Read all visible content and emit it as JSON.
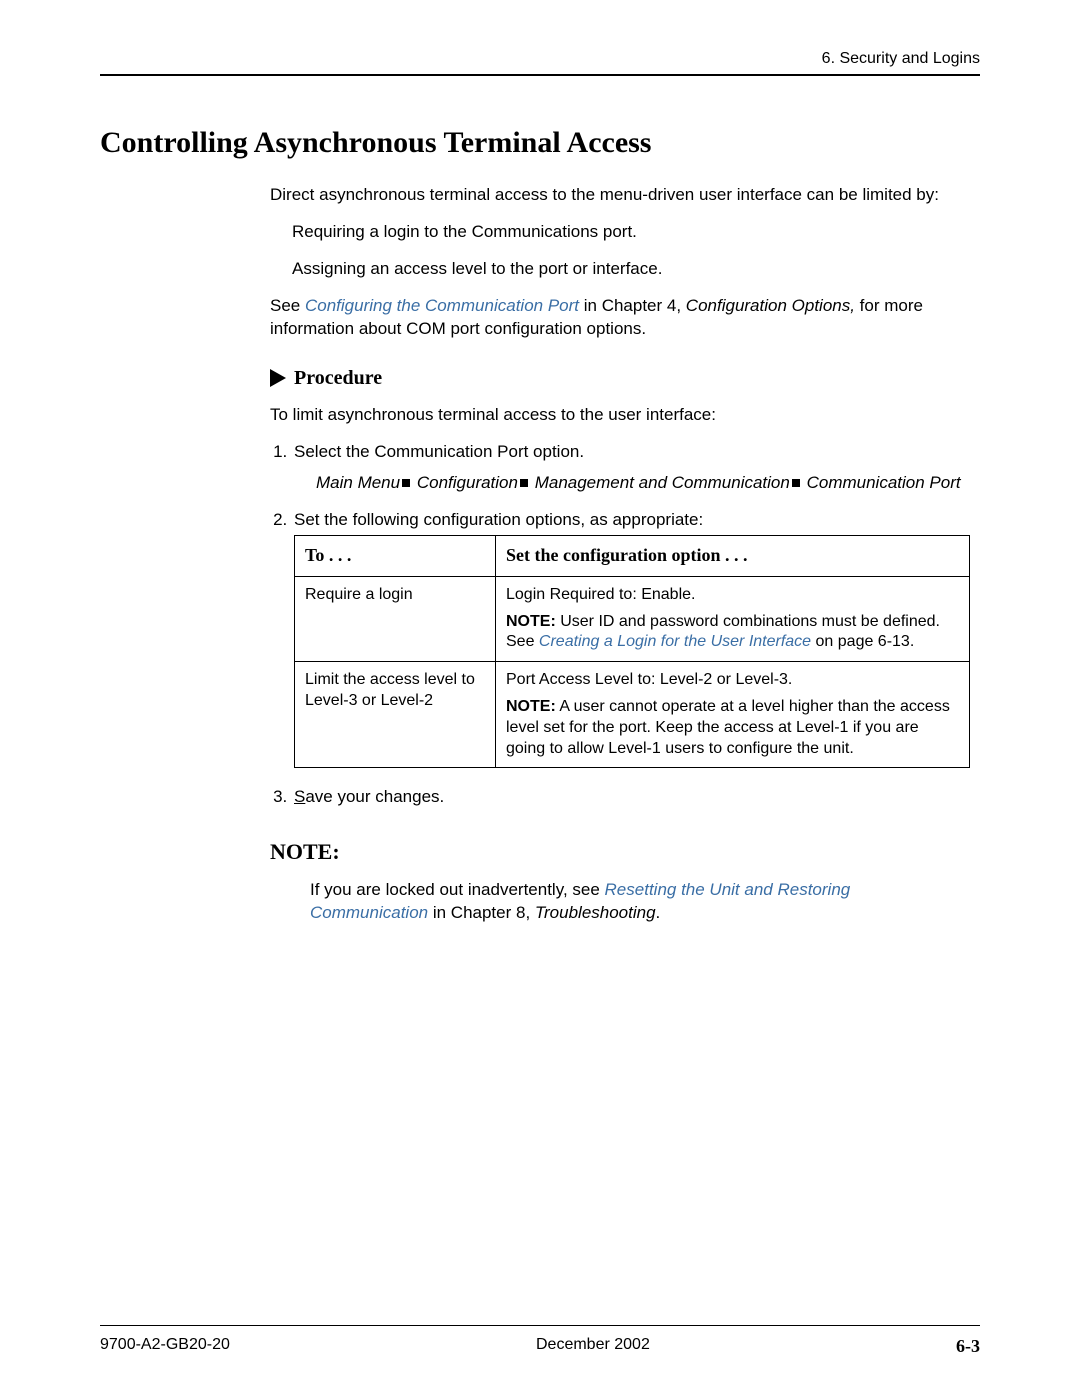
{
  "header": {
    "right": "6. Security and Logins"
  },
  "title": "Controlling Asynchronous Terminal Access",
  "intro": {
    "p1": "Direct asynchronous terminal access to the menu-driven user interface can be limited by:",
    "req1": "Requiring a login to the Communications port.",
    "req2": "Assigning an access level to the port or interface.",
    "see_prefix": "See ",
    "see_link": "Configuring the Communication Port",
    "see_mid": " in Chapter 4, ",
    "see_chapter": "Configuration Options,",
    "see_suffix": " for more information about COM port configuration options."
  },
  "procedure": {
    "label": "Procedure",
    "lead": "To limit asynchronous terminal access to the user interface:",
    "step1": "Select the Communication Port option.",
    "breadcrumb": {
      "a": "Main Menu",
      "b": "Configuration",
      "c": "Management and Communication",
      "d": "Communication Port"
    },
    "step2": "Set the following configuration options, as appropriate:",
    "step3_pre": "S",
    "step3_rest": "ave your changes."
  },
  "table": {
    "h1": "To . . .",
    "h2": "Set the configuration option . . .",
    "r1c1": "Require a login",
    "r1c2_line1": "Login Required to:  Enable.",
    "r1c2_note_label": "NOTE:",
    "r1c2_note_pre": " User ID and password combinations must be defined. See ",
    "r1c2_link": "Creating a Login for the User Interface",
    "r1c2_note_post": " on page 6-13.",
    "r2c1": "Limit the access level to Level-3 or Level-2",
    "r2c2_line1": "Port Access Level to:  Level-2 or Level-3.",
    "r2c2_note_label": "NOTE:",
    "r2c2_note_text": " A user cannot operate at a level higher than the access level set for the port. Keep the access at Level-1 if you are going to allow Level-1 users to configure the unit."
  },
  "note": {
    "heading": "NOTE:",
    "pre": "If you are locked out inadvertently, see ",
    "link": "Resetting the Unit and Restoring Communication",
    "mid": " in Chapter 8, ",
    "chapter": "Troubleshooting",
    "post": "."
  },
  "footer": {
    "left": "9700-A2-GB20-20",
    "center": "December 2002",
    "right": "6-3"
  }
}
